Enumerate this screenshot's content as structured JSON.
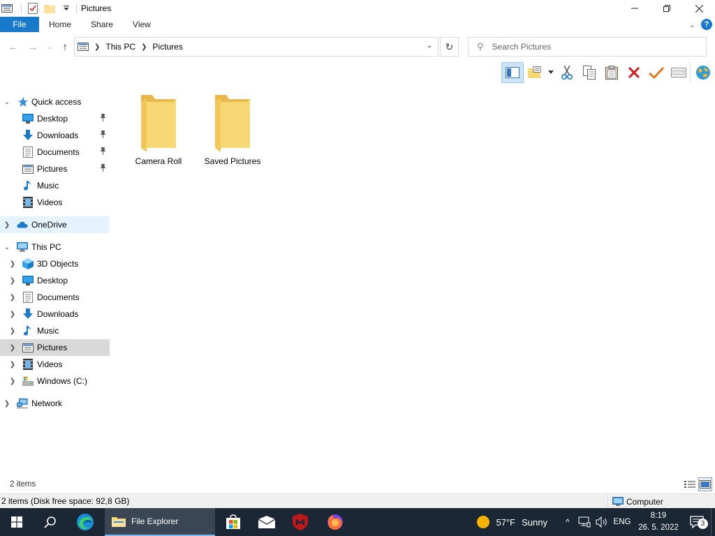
{
  "window": {
    "title": "Pictures"
  },
  "ribbon": {
    "tabs": [
      "File",
      "Home",
      "Share",
      "View"
    ]
  },
  "address": {
    "crumbs": [
      "This PC",
      "Pictures"
    ]
  },
  "search": {
    "placeholder": "Search Pictures"
  },
  "nav": {
    "quick_access": "Quick access",
    "quick_items": [
      {
        "label": "Desktop",
        "icon": "desktop-icon",
        "pinned": true
      },
      {
        "label": "Downloads",
        "icon": "downloads-icon",
        "pinned": true
      },
      {
        "label": "Documents",
        "icon": "documents-icon",
        "pinned": true
      },
      {
        "label": "Pictures",
        "icon": "pictures-icon",
        "pinned": true
      },
      {
        "label": "Music",
        "icon": "music-icon",
        "pinned": false
      },
      {
        "label": "Videos",
        "icon": "videos-icon",
        "pinned": false
      }
    ],
    "onedrive": "OneDrive",
    "this_pc": "This PC",
    "pc_items": [
      {
        "label": "3D Objects",
        "icon": "3d-objects-icon"
      },
      {
        "label": "Desktop",
        "icon": "desktop-icon"
      },
      {
        "label": "Documents",
        "icon": "documents-icon"
      },
      {
        "label": "Downloads",
        "icon": "downloads-icon"
      },
      {
        "label": "Music",
        "icon": "music-icon"
      },
      {
        "label": "Pictures",
        "icon": "pictures-icon"
      },
      {
        "label": "Videos",
        "icon": "videos-icon"
      },
      {
        "label": "Windows (C:)",
        "icon": "drive-icon"
      }
    ],
    "network": "Network"
  },
  "content": {
    "folders": [
      {
        "name": "Camera Roll"
      },
      {
        "name": "Saved Pictures"
      }
    ]
  },
  "status": {
    "item_count": "2 items"
  },
  "details": {
    "info": "2 items (Disk free space: 92,8 GB)",
    "location": "Computer"
  },
  "taskbar": {
    "explorer_label": "File Explorer",
    "weather_temp": "57°F",
    "weather_text": "Sunny",
    "language": "ENG",
    "time": "8:19",
    "date": "26. 5. 2022",
    "notification_count": "3"
  },
  "colors": {
    "accent": "#1979ca",
    "taskbar": "#1b2735",
    "folder": "#f8d775",
    "selection": "#cce4f7"
  }
}
